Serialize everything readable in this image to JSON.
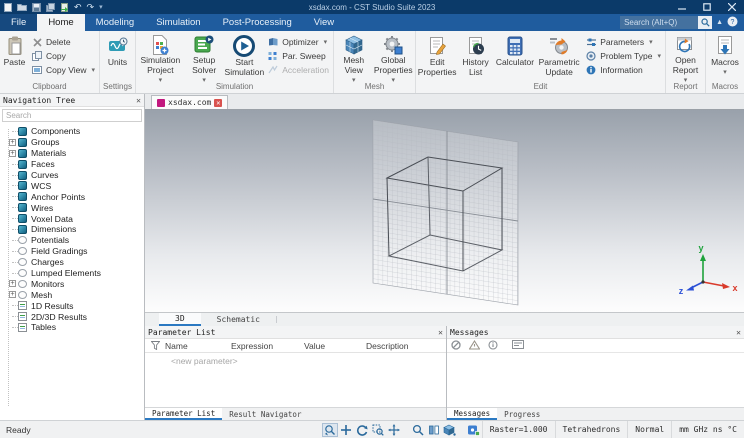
{
  "window": {
    "title": "xsdax.com - CST Studio Suite 2023"
  },
  "qat_icons": [
    "new-file-icon",
    "open-icon",
    "save-icon",
    "save-all-icon",
    "import-icon",
    "undo-icon",
    "redo-icon",
    "qat-customize-icon"
  ],
  "search": {
    "placeholder": "Search (Alt+Q)"
  },
  "menu": {
    "file": "File",
    "tabs": [
      "Home",
      "Modeling",
      "Simulation",
      "Post-Processing",
      "View"
    ],
    "active_tab": "Home"
  },
  "ribbon": {
    "clipboard": {
      "label": "Clipboard",
      "paste": "Paste",
      "delete": "Delete",
      "copy": "Copy",
      "copy_view": "Copy View"
    },
    "settings": {
      "label": "Settings",
      "units": "Units"
    },
    "simulation": {
      "label": "Simulation",
      "simulation_project": "Simulation Project",
      "setup_solver": "Setup Solver",
      "start_simulation": "Start Simulation",
      "optimizer": "Optimizer",
      "par_sweep": "Par. Sweep",
      "acceleration": "Acceleration"
    },
    "mesh": {
      "label": "Mesh",
      "mesh_view": "Mesh View",
      "global_properties": "Global Properties"
    },
    "edit": {
      "label": "Edit",
      "edit_properties": "Edit Properties",
      "history_list": "History List",
      "calculator": "Calculator",
      "parametric_update": "Parametric Update",
      "parameters": "Parameters",
      "problem_type": "Problem Type",
      "information": "Information"
    },
    "report": {
      "label": "Report",
      "open_report": "Open Report"
    },
    "macros_group": {
      "label": "Macros",
      "macros": "Macros"
    }
  },
  "navigation_tree": {
    "title": "Navigation Tree",
    "search_placeholder": "Search",
    "items": [
      {
        "label": "Components"
      },
      {
        "label": "Groups"
      },
      {
        "label": "Materials"
      },
      {
        "label": "Faces"
      },
      {
        "label": "Curves"
      },
      {
        "label": "WCS"
      },
      {
        "label": "Anchor Points"
      },
      {
        "label": "Wires"
      },
      {
        "label": "Voxel Data"
      },
      {
        "label": "Dimensions"
      },
      {
        "label": "Potentials"
      },
      {
        "label": "Field Gradings"
      },
      {
        "label": "Charges"
      },
      {
        "label": "Lumped Elements"
      },
      {
        "label": "Monitors"
      },
      {
        "label": "Mesh"
      },
      {
        "label": "1D Results"
      },
      {
        "label": "2D/3D Results"
      },
      {
        "label": "Tables"
      }
    ]
  },
  "document_tab": {
    "title": "xsdax.com"
  },
  "viewport": {
    "tabs": [
      "3D",
      "Schematic"
    ],
    "active_tab": "3D",
    "axes": {
      "x": "x",
      "y": "y",
      "z": "z"
    },
    "axis_colors": {
      "x": "#d93a2b",
      "y": "#1fa33c",
      "z": "#2a4fd6"
    }
  },
  "parameter_list": {
    "title": "Parameter List",
    "columns": [
      "Name",
      "Expression",
      "Value",
      "Description"
    ],
    "placeholder_row": "<new parameter>",
    "tabs": [
      "Parameter List",
      "Result Navigator"
    ],
    "active_tab": "Parameter List"
  },
  "messages": {
    "title": "Messages",
    "toolbar_icons": [
      "errors-filter-icon",
      "warnings-filter-icon",
      "info-filter-icon",
      "message-log-icon"
    ],
    "tabs": [
      "Messages",
      "Progress"
    ],
    "active_tab": "Messages"
  },
  "status_bar": {
    "ready": "Ready",
    "icons": [
      "pick-zoom-icon",
      "move-icon",
      "rotate-icon",
      "zoom-window-icon",
      "pan-icon",
      "zoom-icon",
      "split-view-icon",
      "bounding-box-icon",
      "raster-icon"
    ],
    "raster": "Raster=1.000",
    "mesh_type": "Tetrahedrons",
    "mode": "Normal",
    "units": "mm GHz ns °C"
  },
  "colors": {
    "titlebar": "#0b3a69",
    "ribbon_blue": "#1f5c9e",
    "accent": "#2b79c2",
    "doc_icon": "#c2187e"
  }
}
